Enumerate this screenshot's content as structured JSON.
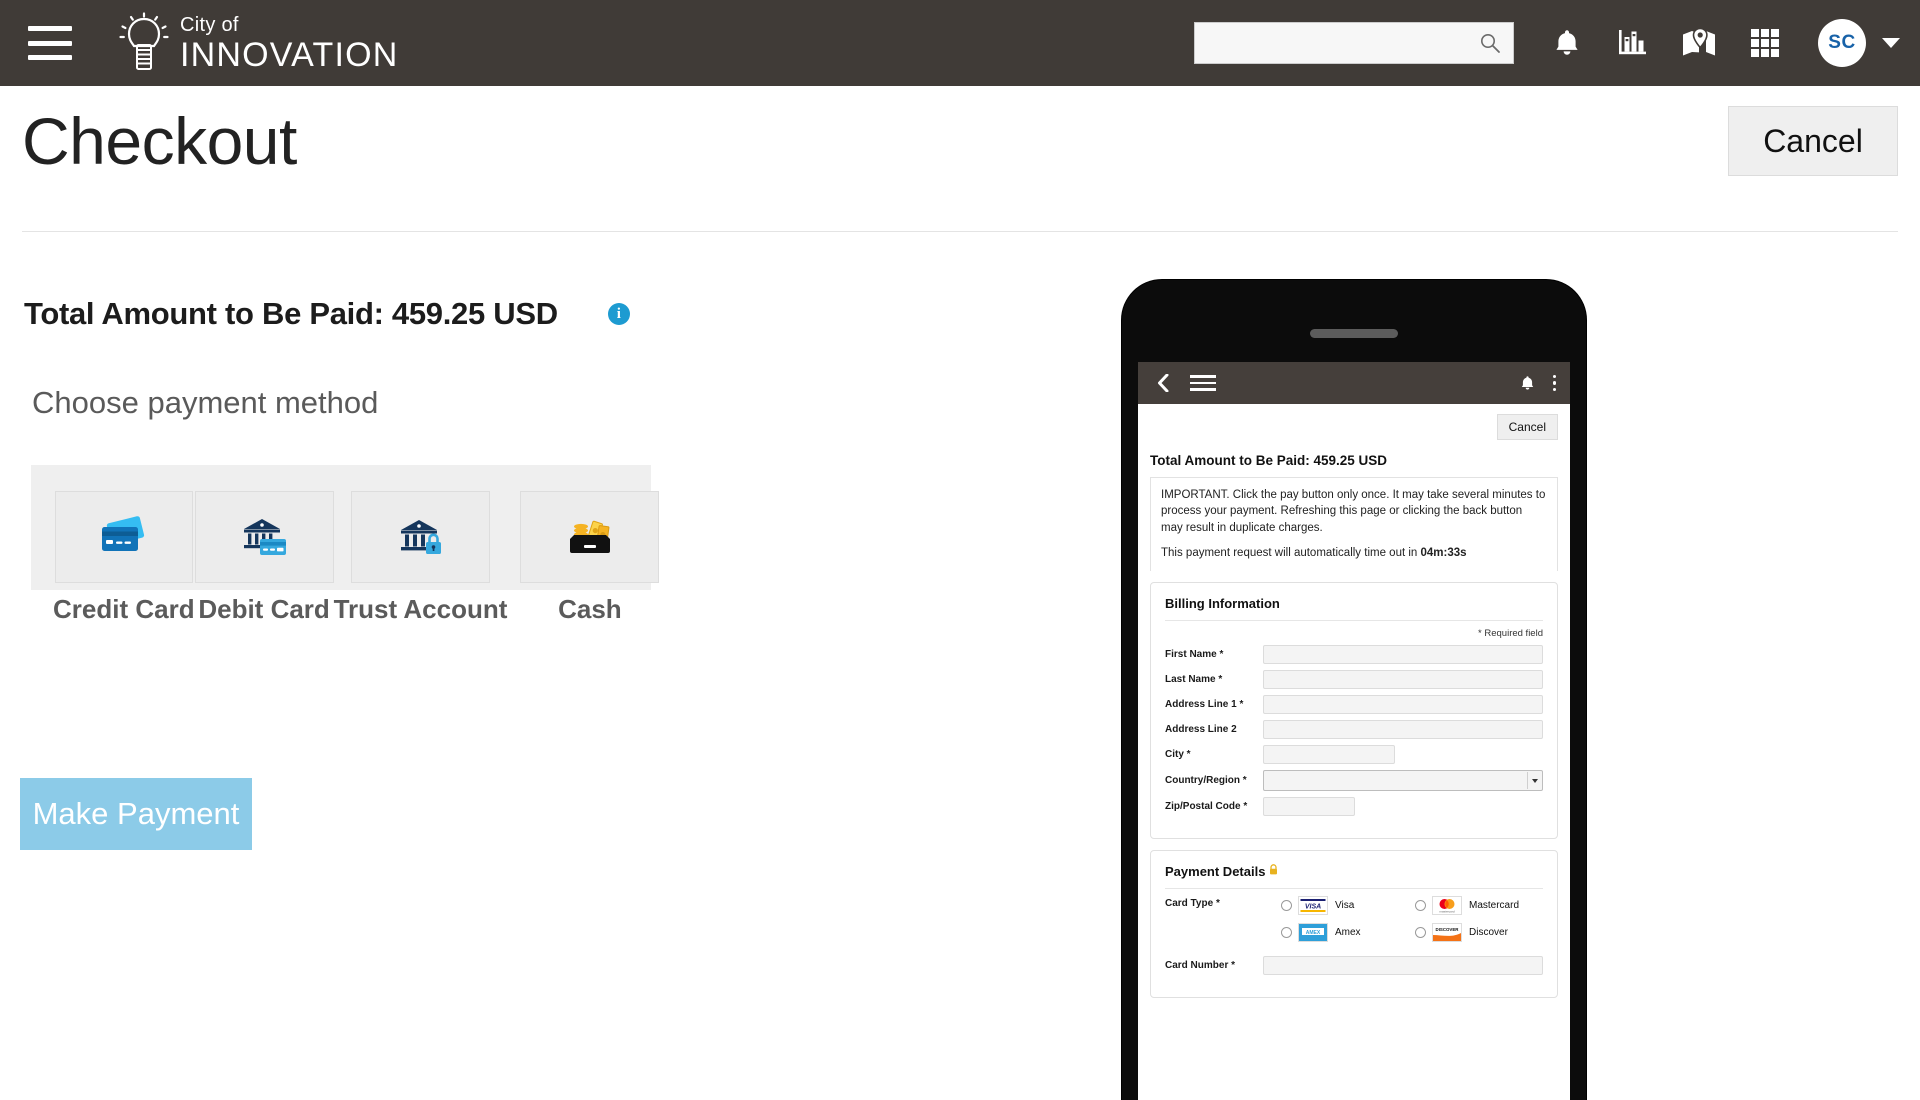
{
  "header": {
    "menu_icon": "hamburger-menu-icon",
    "brand_line1": "City of",
    "brand_line2": "INNOVATION",
    "logo_icon": "lightbulb-icon",
    "search_value": "",
    "search_placeholder": "",
    "search_icon": "search-icon",
    "notifications_icon": "bell-icon",
    "reports_icon": "bar-chart-icon",
    "map_icon": "map-pin-icon",
    "apps_icon": "grid-apps-icon",
    "avatar_initials": "SC",
    "caret_icon": "chevron-down-icon",
    "bar_color": "#403b37",
    "avatar_text_color": "#1862a8"
  },
  "page": {
    "title": "Checkout",
    "cancel_label": "Cancel"
  },
  "main": {
    "total_label": "Total Amount to Be Paid: 459.25 USD",
    "info_icon": "info-icon",
    "info_glyph": "i",
    "info_color": "#1d9bd1",
    "choose_label": "Choose payment method",
    "methods": [
      {
        "label": "Credit Card",
        "icon": "credit-cards-icon"
      },
      {
        "label": "Debit Card",
        "icon": "bank-with-card-icon"
      },
      {
        "label": "Trust Account",
        "icon": "bank-with-lock-icon"
      },
      {
        "label": "Cash",
        "icon": "cash-drawer-icon"
      }
    ],
    "pay_button_label": "Make Payment",
    "pay_button_color": "#8ccbe8"
  },
  "phone": {
    "appbar": {
      "back_icon": "back-chevron-icon",
      "menu_icon": "hamburger-menu-icon",
      "bell_icon": "bell-icon",
      "kebab_icon": "more-vertical-icon"
    },
    "cancel_label": "Cancel",
    "total_label": "Total Amount to Be Paid: 459.25 USD",
    "notice_line1": "IMPORTANT. Click the pay button only once. It may take several minutes to process your payment. Refreshing this page or clicking the back button may result in duplicate charges.",
    "notice_line2_prefix": "This payment request will automatically time out in ",
    "timeout_value": "04m:33s",
    "billing": {
      "heading": "Billing Information",
      "required_note": "* Required field",
      "fields": [
        {
          "label": "First Name *",
          "value": "",
          "type": "text"
        },
        {
          "label": "Last Name *",
          "value": "",
          "type": "text"
        },
        {
          "label": "Address Line 1 *",
          "value": "",
          "type": "text"
        },
        {
          "label": "Address Line 2",
          "value": "",
          "type": "text"
        },
        {
          "label": "City *",
          "value": "",
          "type": "text-short"
        },
        {
          "label": "Country/Region *",
          "value": "",
          "type": "select"
        },
        {
          "label": "Zip/Postal Code *",
          "value": "",
          "type": "text-zip"
        }
      ]
    },
    "payment": {
      "heading": "Payment Details",
      "lock_icon": "lock-icon",
      "lock_color": "#e8b21f",
      "card_type_label": "Card Type *",
      "card_types": [
        {
          "name": "Visa",
          "icon": "visa-logo",
          "selected": false
        },
        {
          "name": "Mastercard",
          "icon": "mastercard-logo",
          "selected": false
        },
        {
          "name": "Amex",
          "icon": "amex-logo",
          "selected": false
        },
        {
          "name": "Discover",
          "icon": "discover-logo",
          "selected": false
        }
      ],
      "card_number_label": "Card Number *",
      "card_number_value": ""
    }
  }
}
